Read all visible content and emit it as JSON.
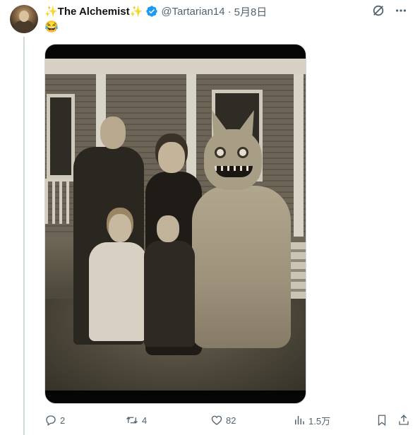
{
  "tweet": {
    "author_name": "✨The Alchemist✨",
    "handle": "@Tartarian14",
    "separator": "·",
    "date": "5月8日",
    "text": "😂"
  },
  "actions": {
    "reply_count": "2",
    "retweet_count": "4",
    "like_count": "82",
    "views_count": "1.5万"
  },
  "colors": {
    "verified_badge": "#1d9bf0",
    "secondary_text": "#536471",
    "thread_line": "#cfd9de"
  },
  "icons": {
    "verified": "verified-badge-icon",
    "grok": "grok-icon",
    "more": "more-icon",
    "reply": "reply-icon",
    "retweet": "retweet-icon",
    "like": "like-icon",
    "views": "views-icon",
    "bookmark": "bookmark-icon",
    "share": "share-icon"
  }
}
